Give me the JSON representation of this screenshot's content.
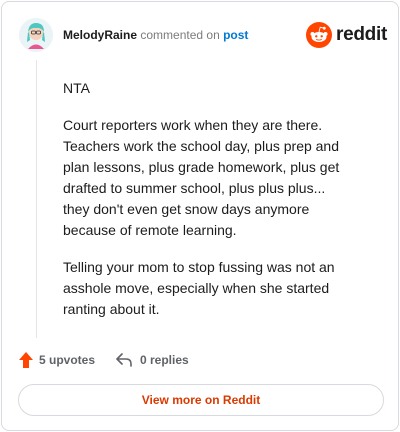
{
  "header": {
    "username": "MelodyRaine",
    "action_text": "commented on",
    "post_link": "post",
    "brand": "reddit"
  },
  "comment": {
    "paragraphs": [
      "NTA",
      "Court reporters work when they are there. Teachers work the school day, plus prep and plan lessons, plus grade homework, plus get drafted to summer school, plus plus plus... they don't even get snow days anymore because of remote learning.",
      "Telling your mom to stop fussing was not an asshole move, especially when she started ranting about it."
    ]
  },
  "actions": {
    "upvotes": "5 upvotes",
    "replies": "0 replies"
  },
  "footer": {
    "view_more": "View more on Reddit"
  },
  "colors": {
    "brand": "#ff4500",
    "accent_link": "#0079d3",
    "view_more": "#d93a00"
  },
  "icons": [
    "avatar",
    "reddit-logo-icon",
    "upvote-arrow-icon",
    "reply-arrow-icon"
  ]
}
